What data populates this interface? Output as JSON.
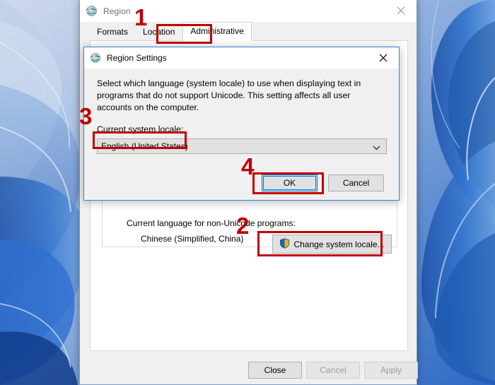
{
  "desktop": {
    "wallpaper_name": "windows-abstract-blue-ribbons"
  },
  "region_window": {
    "title": "Region",
    "title_icon": "globe-icon",
    "close_icon": "close-icon",
    "tabs": [
      {
        "label": "Formats",
        "selected": false
      },
      {
        "label": "Location",
        "selected": false
      },
      {
        "label": "Administrative",
        "selected": true
      }
    ],
    "group": {
      "line1": "Current language for non-Unicode programs:",
      "line2": "Chinese (Simplified, China)",
      "change_button": {
        "label": "Change system locale...",
        "icon": "uac-shield-icon"
      }
    },
    "footer_buttons": [
      {
        "label": "Close",
        "disabled": false
      },
      {
        "label": "Cancel",
        "disabled": true
      },
      {
        "label": "Apply",
        "disabled": true
      }
    ]
  },
  "settings_dialog": {
    "title": "Region Settings",
    "title_icon": "globe-icon",
    "close_icon": "close-icon",
    "description": "Select which language (system locale) to use when displaying text in programs that do not support Unicode. This setting affects all user accounts on the computer.",
    "locale_label": "Current system locale:",
    "locale_value": "English (United States)",
    "locale_dropdown_icon": "chevron-down-icon",
    "ok_label": "OK",
    "cancel_label": "Cancel"
  },
  "annotations": {
    "step1": "1",
    "step2": "2",
    "step3": "3",
    "step4": "4",
    "color": "#c00000"
  }
}
